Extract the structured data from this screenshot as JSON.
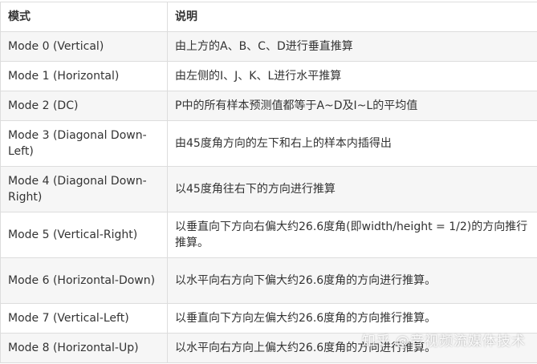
{
  "table": {
    "headers": [
      "模式",
      "说明"
    ],
    "rows": [
      {
        "mode": "Mode 0 (Vertical)",
        "desc": "由上方的A、B、C、D进行垂直推算"
      },
      {
        "mode": "Mode 1 (Horizontal)",
        "desc": "由左侧的I、J、K、L进行水平推算"
      },
      {
        "mode": "Mode 2 (DC)",
        "desc": "P中的所有样本预测值都等于A~D及I~L的平均值"
      },
      {
        "mode": "Mode 3 (Diagonal Down-Left)",
        "desc": "由45度角方向的左下和右上的样本内插得出"
      },
      {
        "mode": "Mode 4 (Diagonal Down-Right)",
        "desc": "以45度角往右下的方向进行推算"
      },
      {
        "mode": "Mode 5 (Vertical-Right)",
        "desc": "以垂直向下方向右偏大约26.6度角(即width/height = 1/2)的方向推行推算。"
      },
      {
        "mode": "Mode 6 (Horizontal-Down)",
        "desc": "以水平向右方向下偏大约26.6度角的方向进行推算。"
      },
      {
        "mode": "Mode 7 (Vertical-Left)",
        "desc": "以垂直向下方向左偏大约26.6度角的方向推行推算。"
      },
      {
        "mode": "Mode 8 (Horizontal-Up)",
        "desc": "以水平向右方向上偏大约26.6度角的方向进行推算。"
      }
    ]
  },
  "watermark": "知乎 @音视频流媒体技术"
}
